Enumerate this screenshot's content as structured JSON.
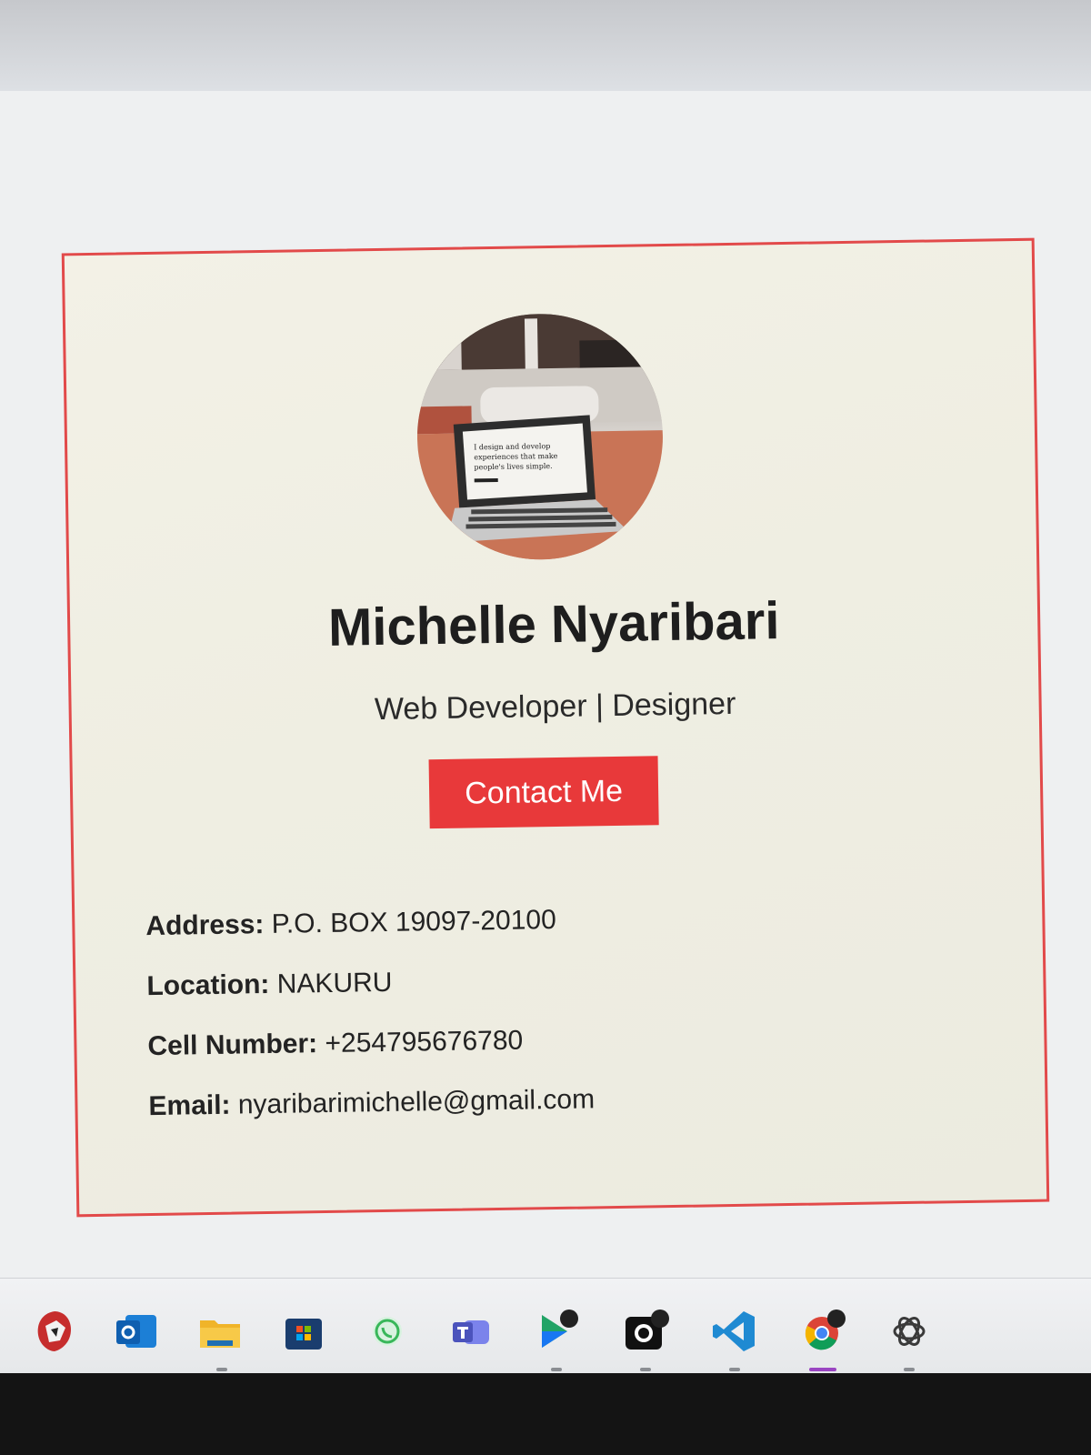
{
  "profile": {
    "name": "Michelle Nyaribari",
    "subtitle": "Web Developer | Designer",
    "contact_button_label": "Contact Me",
    "avatar_caption_lines": [
      "I design and develop",
      "experiences that make",
      "people's lives simple."
    ]
  },
  "details": [
    {
      "label": "Address:",
      "value": "P.O. BOX 19097-20100"
    },
    {
      "label": "Location:",
      "value": "NAKURU"
    },
    {
      "label": "Cell Number:",
      "value": "+254795676780"
    },
    {
      "label": "Email:",
      "value": "nyaribarimichelle@gmail.com"
    }
  ],
  "colors": {
    "accent_red": "#e8393a",
    "card_border": "#e24a4a",
    "text_dark": "#1e1e1e"
  },
  "taskbar": {
    "icons": [
      "brave-lion-icon",
      "outlook-icon",
      "file-explorer-icon",
      "microsoft-store-icon",
      "whatsapp-icon",
      "teams-icon",
      "media-player-icon",
      "github-desktop-icon",
      "vscode-icon",
      "chrome-icon",
      "chatgpt-icon"
    ]
  }
}
